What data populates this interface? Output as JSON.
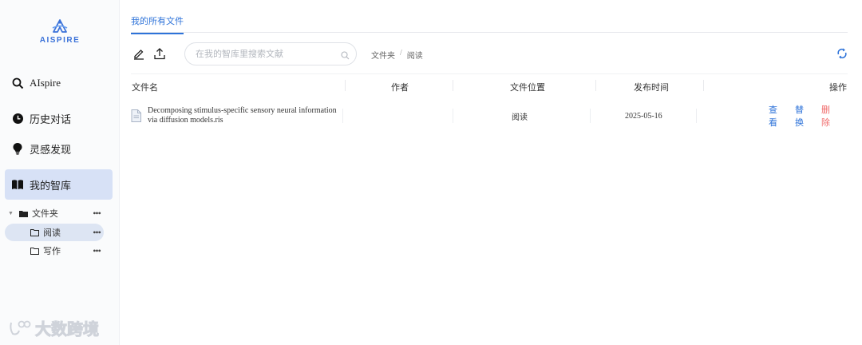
{
  "brand": {
    "logo_text": "AISPIRE"
  },
  "sidebar": {
    "nav": [
      {
        "label": "AIspire",
        "icon": "search-icon"
      },
      {
        "label": "历史对话",
        "icon": "clock-icon"
      },
      {
        "label": "灵感发现",
        "icon": "lightbulb-icon"
      },
      {
        "label": "我的智库",
        "icon": "book-icon",
        "active": true
      }
    ],
    "tree": {
      "root": {
        "label": "文件夹",
        "icon": "folder-icon",
        "expanded": true
      },
      "children": [
        {
          "label": "阅读",
          "icon": "folder-outline-icon",
          "active": true
        },
        {
          "label": "写作",
          "icon": "folder-outline-icon",
          "active": false
        }
      ],
      "more": "•••"
    }
  },
  "watermark": "大数跨境",
  "main": {
    "tab": "我的所有文件",
    "search": {
      "placeholder": "在我的智库里搜索文献",
      "value": ""
    },
    "breadcrumb": [
      "文件夹",
      "阅读"
    ],
    "breadcrumb_sep": "/",
    "columns": {
      "name": "文件名",
      "author": "作者",
      "location": "文件位置",
      "published": "发布时间",
      "actions": "操作"
    },
    "rows": [
      {
        "name": "Decomposing stimulus-specific sensory neural information via diffusion models.ris",
        "author": "",
        "location": "阅读",
        "published": "2025-05-16",
        "actions": {
          "view": "查看",
          "replace": "替换",
          "delete": "删除"
        }
      }
    ]
  },
  "colors": {
    "accent": "#2e73d9",
    "danger": "#f06b6b",
    "active_bg": "#d7e1f6"
  }
}
